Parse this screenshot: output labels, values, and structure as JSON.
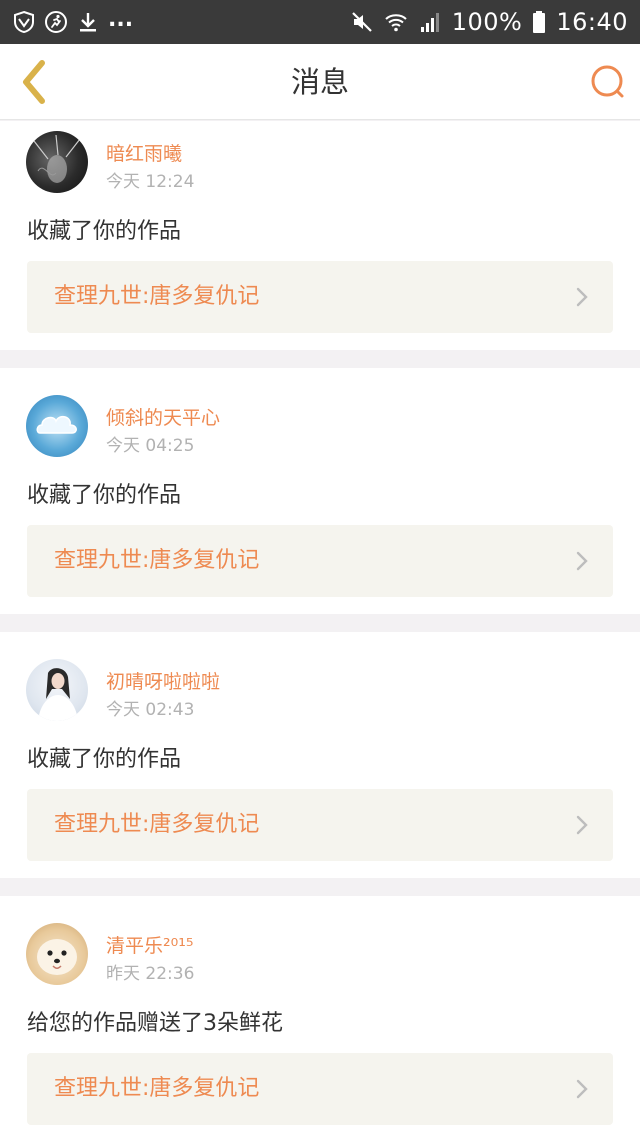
{
  "status_bar": {
    "left_icons": [
      "shield-icon",
      "running-icon",
      "download-icon"
    ],
    "more": "...",
    "battery": "100%",
    "time": "16:40"
  },
  "header": {
    "title": "消息",
    "back_icon": "chevron-left-icon",
    "search_icon": "search-icon"
  },
  "colors": {
    "accent": "#ee8a51",
    "back_arrow": "#d9b24a",
    "card_bg": "#ffffff",
    "work_bg": "#f5f4ee",
    "page_bg": "#f3f1f3"
  },
  "messages": [
    {
      "user": "暗红雨曦",
      "time": "今天 12:24",
      "action": "收藏了你的作品",
      "work": "查理九世:唐多复仇记"
    },
    {
      "user": "倾斜的天平心",
      "time": "今天 04:25",
      "action": "收藏了你的作品",
      "work": "查理九世:唐多复仇记"
    },
    {
      "user": "初晴呀啦啦啦",
      "time": "今天 02:43",
      "action": "收藏了你的作品",
      "work": "查理九世:唐多复仇记"
    },
    {
      "user": "清平乐²⁰¹⁵",
      "time": "昨天 22:36",
      "action": "给您的作品赠送了3朵鲜花",
      "work": "查理九世:唐多复仇记"
    }
  ]
}
